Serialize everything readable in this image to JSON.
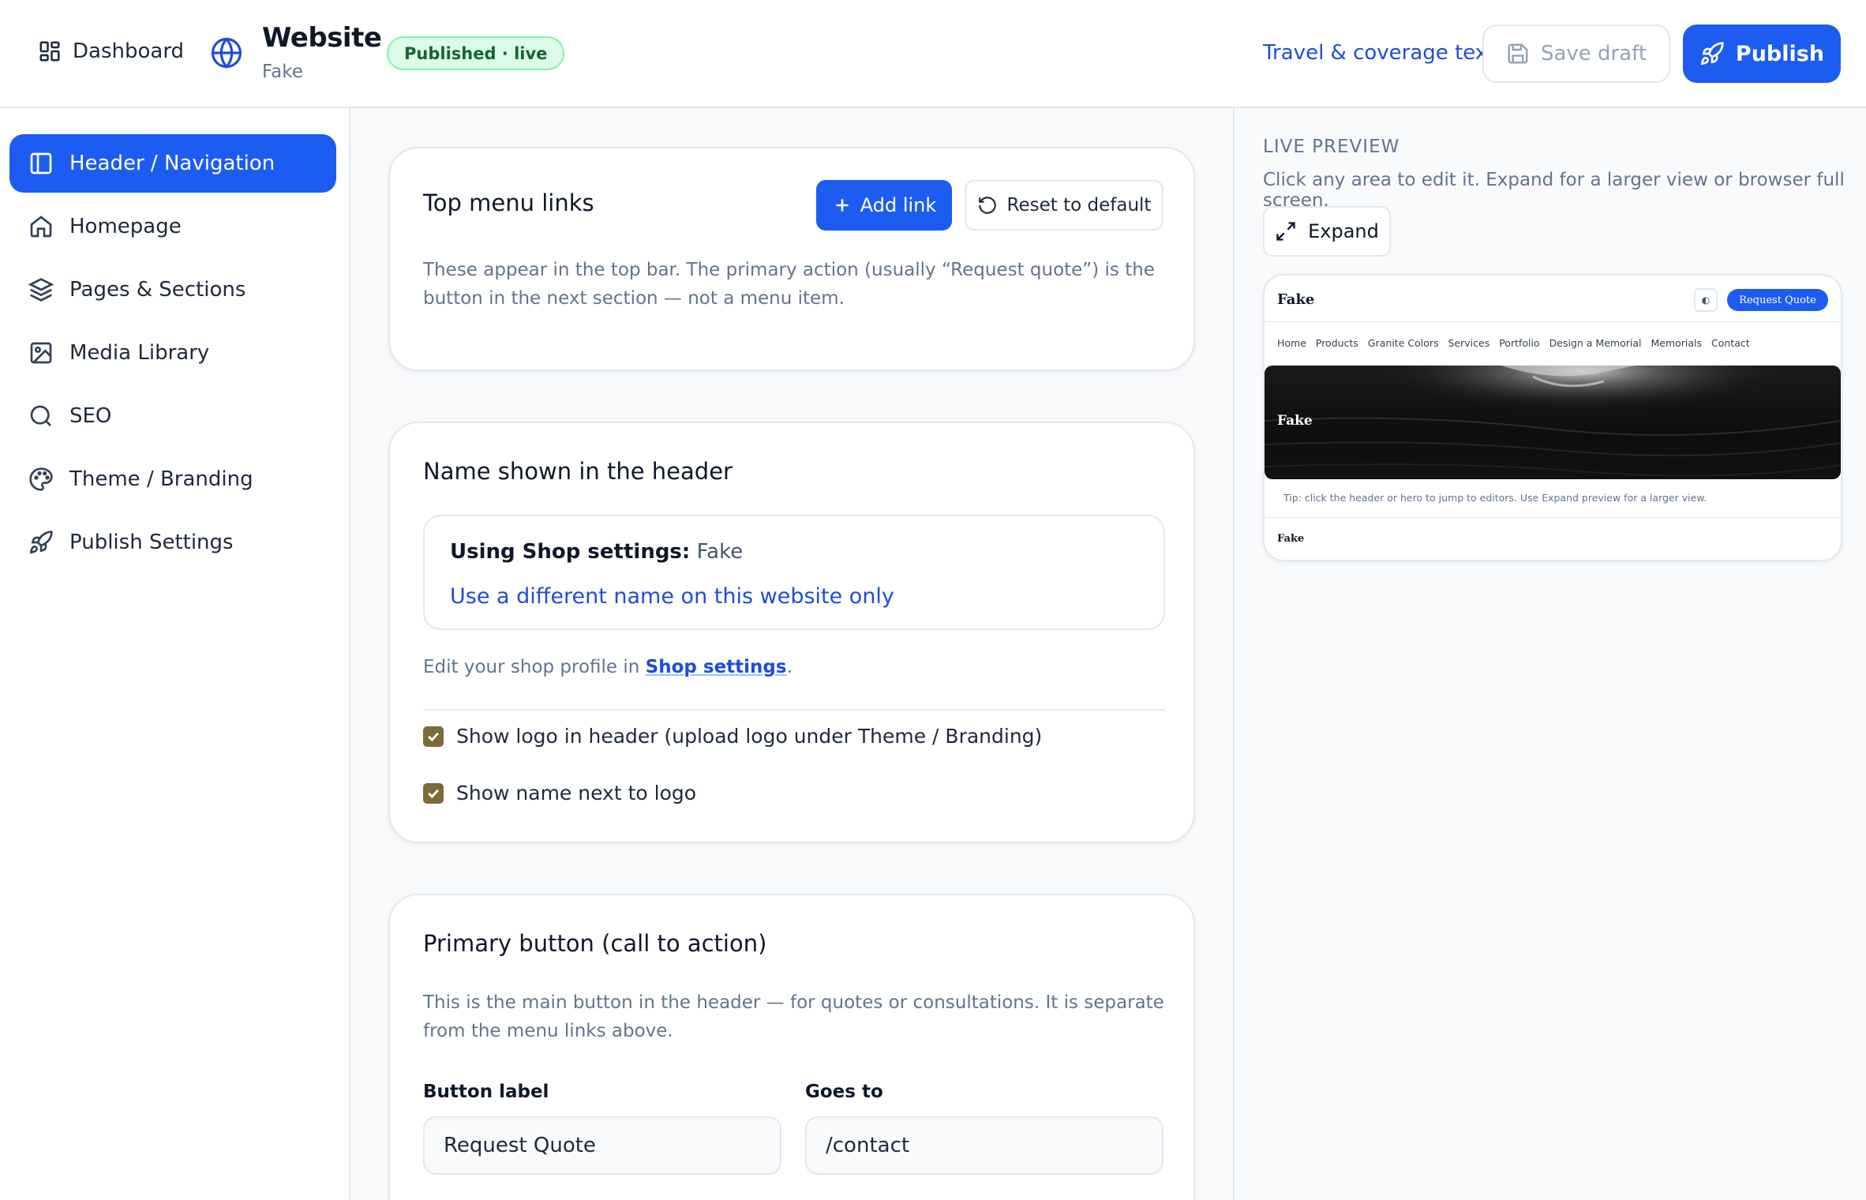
{
  "topbar": {
    "dashboard_label": "Dashboard",
    "site_title": "Website",
    "site_subtitle": "Fake",
    "status_badge": "Published · live",
    "travel_link": "Travel & coverage text",
    "save_draft": "Save draft",
    "publish": "Publish"
  },
  "sidebar": {
    "items": [
      {
        "label": "Header / Navigation",
        "icon": "panel-icon",
        "active": true
      },
      {
        "label": "Homepage",
        "icon": "home-icon"
      },
      {
        "label": "Pages & Sections",
        "icon": "layers-icon"
      },
      {
        "label": "Media Library",
        "icon": "image-icon"
      },
      {
        "label": "SEO",
        "icon": "search-icon"
      },
      {
        "label": "Theme / Branding",
        "icon": "palette-icon"
      },
      {
        "label": "Publish Settings",
        "icon": "rocket-icon"
      }
    ]
  },
  "menu_card": {
    "title": "Top menu links",
    "add_link": "Add link",
    "reset": "Reset to default",
    "desc": "These appear in the top bar. The primary action (usually “Request quote”) is the button in the next section — not a menu item."
  },
  "name_card": {
    "title": "Name shown in the header",
    "using_label": "Using Shop settings:",
    "using_value": "Fake",
    "different_name_link": "Use a different name on this website only",
    "shop_line_prefix": "Edit your shop profile in",
    "shop_line_link": "Shop settings",
    "shop_line_suffix": ".",
    "check_logo": "Show logo in header (upload logo under Theme / Branding)",
    "check_name": "Show name next to logo"
  },
  "cta_card": {
    "title": "Primary button (call to action)",
    "desc": "This is the main button in the header — for quotes or consultations. It is separate from the menu links above.",
    "label_label": "Button label",
    "label_value": "Request Quote",
    "goes_label": "Goes to",
    "goes_value": "/contact"
  },
  "preview": {
    "title": "LIVE PREVIEW",
    "desc": "Click any area to edit it. Expand for a larger view or browser full screen.",
    "expand": "Expand",
    "brand": "Fake",
    "toggle": "◐",
    "cta": "Request Quote",
    "nav": [
      "Home",
      "Products",
      "Granite Colors",
      "Services",
      "Portfolio",
      "Design a Memorial",
      "Memorials",
      "Contact"
    ],
    "hero_text": "Fake",
    "tip": "Tip: click the header or hero to jump to editors. Use Expand preview for a larger view.",
    "footer": "Fake"
  },
  "colors": {
    "accent": "#1d5cf0",
    "link": "#1d4ed8",
    "badge_bg": "#dcfce7",
    "badge_text": "#166534",
    "checkbox": "#7c6a3a"
  }
}
